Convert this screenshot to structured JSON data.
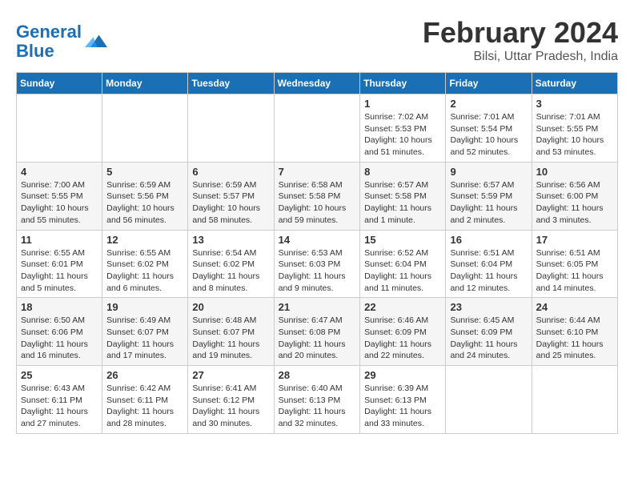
{
  "header": {
    "logo_line1": "General",
    "logo_line2": "Blue",
    "month": "February 2024",
    "location": "Bilsi, Uttar Pradesh, India"
  },
  "weekdays": [
    "Sunday",
    "Monday",
    "Tuesday",
    "Wednesday",
    "Thursday",
    "Friday",
    "Saturday"
  ],
  "weeks": [
    [
      {
        "day": "",
        "info": ""
      },
      {
        "day": "",
        "info": ""
      },
      {
        "day": "",
        "info": ""
      },
      {
        "day": "",
        "info": ""
      },
      {
        "day": "1",
        "info": "Sunrise: 7:02 AM\nSunset: 5:53 PM\nDaylight: 10 hours\nand 51 minutes."
      },
      {
        "day": "2",
        "info": "Sunrise: 7:01 AM\nSunset: 5:54 PM\nDaylight: 10 hours\nand 52 minutes."
      },
      {
        "day": "3",
        "info": "Sunrise: 7:01 AM\nSunset: 5:55 PM\nDaylight: 10 hours\nand 53 minutes."
      }
    ],
    [
      {
        "day": "4",
        "info": "Sunrise: 7:00 AM\nSunset: 5:55 PM\nDaylight: 10 hours\nand 55 minutes."
      },
      {
        "day": "5",
        "info": "Sunrise: 6:59 AM\nSunset: 5:56 PM\nDaylight: 10 hours\nand 56 minutes."
      },
      {
        "day": "6",
        "info": "Sunrise: 6:59 AM\nSunset: 5:57 PM\nDaylight: 10 hours\nand 58 minutes."
      },
      {
        "day": "7",
        "info": "Sunrise: 6:58 AM\nSunset: 5:58 PM\nDaylight: 10 hours\nand 59 minutes."
      },
      {
        "day": "8",
        "info": "Sunrise: 6:57 AM\nSunset: 5:58 PM\nDaylight: 11 hours\nand 1 minute."
      },
      {
        "day": "9",
        "info": "Sunrise: 6:57 AM\nSunset: 5:59 PM\nDaylight: 11 hours\nand 2 minutes."
      },
      {
        "day": "10",
        "info": "Sunrise: 6:56 AM\nSunset: 6:00 PM\nDaylight: 11 hours\nand 3 minutes."
      }
    ],
    [
      {
        "day": "11",
        "info": "Sunrise: 6:55 AM\nSunset: 6:01 PM\nDaylight: 11 hours\nand 5 minutes."
      },
      {
        "day": "12",
        "info": "Sunrise: 6:55 AM\nSunset: 6:02 PM\nDaylight: 11 hours\nand 6 minutes."
      },
      {
        "day": "13",
        "info": "Sunrise: 6:54 AM\nSunset: 6:02 PM\nDaylight: 11 hours\nand 8 minutes."
      },
      {
        "day": "14",
        "info": "Sunrise: 6:53 AM\nSunset: 6:03 PM\nDaylight: 11 hours\nand 9 minutes."
      },
      {
        "day": "15",
        "info": "Sunrise: 6:52 AM\nSunset: 6:04 PM\nDaylight: 11 hours\nand 11 minutes."
      },
      {
        "day": "16",
        "info": "Sunrise: 6:51 AM\nSunset: 6:04 PM\nDaylight: 11 hours\nand 12 minutes."
      },
      {
        "day": "17",
        "info": "Sunrise: 6:51 AM\nSunset: 6:05 PM\nDaylight: 11 hours\nand 14 minutes."
      }
    ],
    [
      {
        "day": "18",
        "info": "Sunrise: 6:50 AM\nSunset: 6:06 PM\nDaylight: 11 hours\nand 16 minutes."
      },
      {
        "day": "19",
        "info": "Sunrise: 6:49 AM\nSunset: 6:07 PM\nDaylight: 11 hours\nand 17 minutes."
      },
      {
        "day": "20",
        "info": "Sunrise: 6:48 AM\nSunset: 6:07 PM\nDaylight: 11 hours\nand 19 minutes."
      },
      {
        "day": "21",
        "info": "Sunrise: 6:47 AM\nSunset: 6:08 PM\nDaylight: 11 hours\nand 20 minutes."
      },
      {
        "day": "22",
        "info": "Sunrise: 6:46 AM\nSunset: 6:09 PM\nDaylight: 11 hours\nand 22 minutes."
      },
      {
        "day": "23",
        "info": "Sunrise: 6:45 AM\nSunset: 6:09 PM\nDaylight: 11 hours\nand 24 minutes."
      },
      {
        "day": "24",
        "info": "Sunrise: 6:44 AM\nSunset: 6:10 PM\nDaylight: 11 hours\nand 25 minutes."
      }
    ],
    [
      {
        "day": "25",
        "info": "Sunrise: 6:43 AM\nSunset: 6:11 PM\nDaylight: 11 hours\nand 27 minutes."
      },
      {
        "day": "26",
        "info": "Sunrise: 6:42 AM\nSunset: 6:11 PM\nDaylight: 11 hours\nand 28 minutes."
      },
      {
        "day": "27",
        "info": "Sunrise: 6:41 AM\nSunset: 6:12 PM\nDaylight: 11 hours\nand 30 minutes."
      },
      {
        "day": "28",
        "info": "Sunrise: 6:40 AM\nSunset: 6:13 PM\nDaylight: 11 hours\nand 32 minutes."
      },
      {
        "day": "29",
        "info": "Sunrise: 6:39 AM\nSunset: 6:13 PM\nDaylight: 11 hours\nand 33 minutes."
      },
      {
        "day": "",
        "info": ""
      },
      {
        "day": "",
        "info": ""
      }
    ]
  ]
}
